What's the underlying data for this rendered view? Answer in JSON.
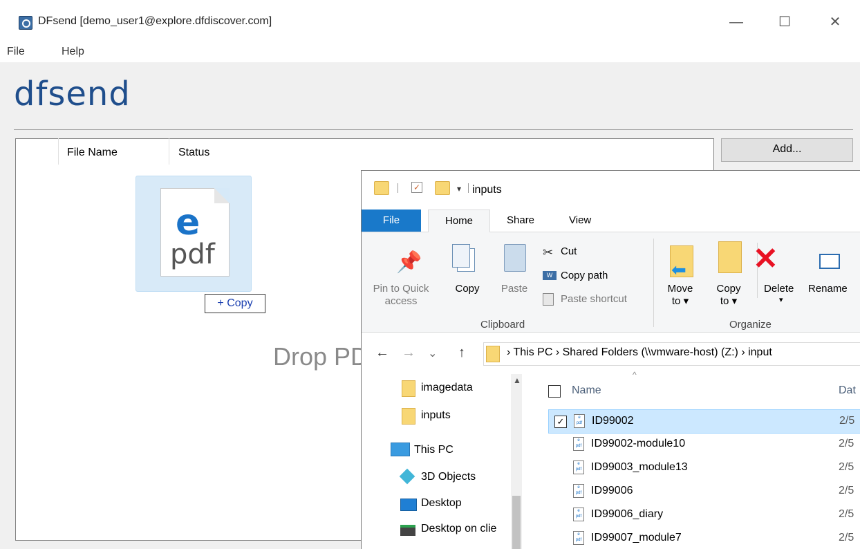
{
  "window": {
    "title": "DFsend [demo_user1@explore.dfdiscover.com]",
    "minimize": "—",
    "maximize": "☐",
    "close": "✕"
  },
  "menu": [
    "File",
    "Help"
  ],
  "brand": "dfsend",
  "table": {
    "col_file_name": "File Name",
    "col_status": "Status",
    "drop_text": "Drop PD"
  },
  "add_button": "Add...",
  "drag": {
    "badge": "+ Copy",
    "icon_letter": "e",
    "icon_label": "pdf"
  },
  "explorer": {
    "title": "inputs",
    "tabs": [
      "File",
      "Home",
      "Share",
      "View"
    ],
    "clipboard": {
      "pin": "Pin to Quick\naccess",
      "copy": "Copy",
      "paste": "Paste",
      "cut": "Cut",
      "copy_path": "Copy path",
      "paste_shortcut": "Paste shortcut",
      "group": "Clipboard"
    },
    "organize": {
      "move": "Move\nto ▾",
      "copy": "Copy\nto ▾",
      "delete": "Delete",
      "delete_arrow": "▾",
      "rename": "Rename",
      "group": "Organize"
    },
    "nav": {
      "back": "←",
      "forward": "→",
      "recent": "⌄",
      "up": "↑"
    },
    "address": "›  This PC  ›  Shared Folders (\\\\vmware-host) (Z:)  ›  input",
    "nav_pane": [
      "imagedata",
      "inputs",
      "This PC",
      "3D Objects",
      "Desktop",
      "Desktop on clie"
    ],
    "list_header": {
      "name": "Name",
      "date": "Dat"
    },
    "files": [
      {
        "name": "ID99002",
        "date": "2/5",
        "selected": true
      },
      {
        "name": "ID99002-module10",
        "date": "2/5"
      },
      {
        "name": "ID99003_module13",
        "date": "2/5"
      },
      {
        "name": "ID99006",
        "date": "2/5"
      },
      {
        "name": "ID99006_diary",
        "date": "2/5"
      },
      {
        "name": "ID99007_module7",
        "date": "2/5"
      }
    ]
  }
}
